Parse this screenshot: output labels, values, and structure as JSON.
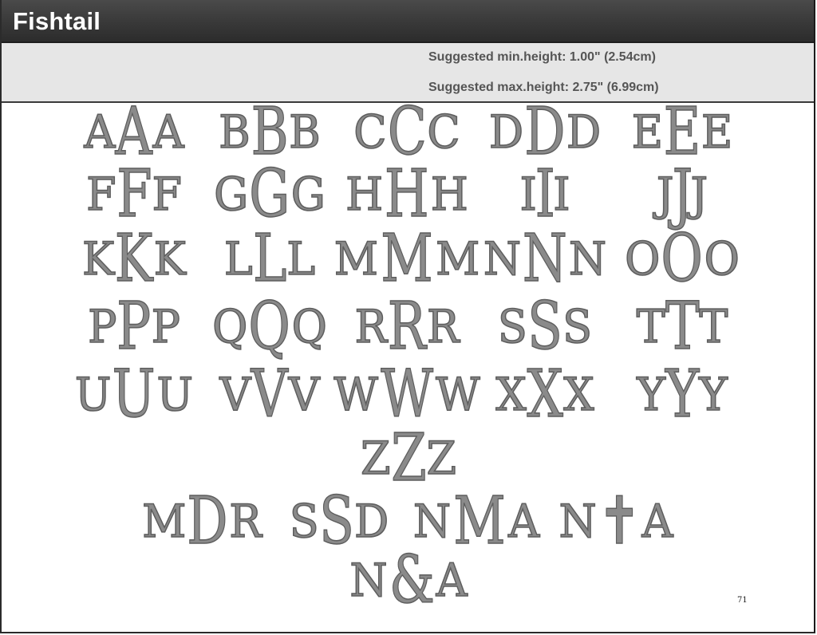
{
  "header": {
    "title": "Fishtail"
  },
  "info": {
    "min_height": "Suggested min.height: 1.00\" (2.54cm)",
    "max_height": "Suggested max.height: 2.75\" (6.99cm)"
  },
  "monograms": {
    "row1": [
      "AAA",
      "BBB",
      "CCC",
      "DDD",
      "EEE"
    ],
    "row2": [
      "FFF",
      "GGG",
      "HHH",
      "III",
      "JJJ"
    ],
    "row3": [
      "KKK",
      "LLL",
      "MMM",
      "NNN",
      "OOO"
    ],
    "row4": [
      "PPP",
      "QQQ",
      "RRR",
      "SSS",
      "TTT"
    ],
    "row5": [
      "UUU",
      "VVV",
      "WWW",
      "XXX",
      "YYY"
    ],
    "row6": [
      "ZZZ"
    ],
    "examples": [
      "MDR",
      "SSD",
      "NMA",
      "N✝A"
    ],
    "ampersand": "N&A"
  },
  "page_number": "71"
}
